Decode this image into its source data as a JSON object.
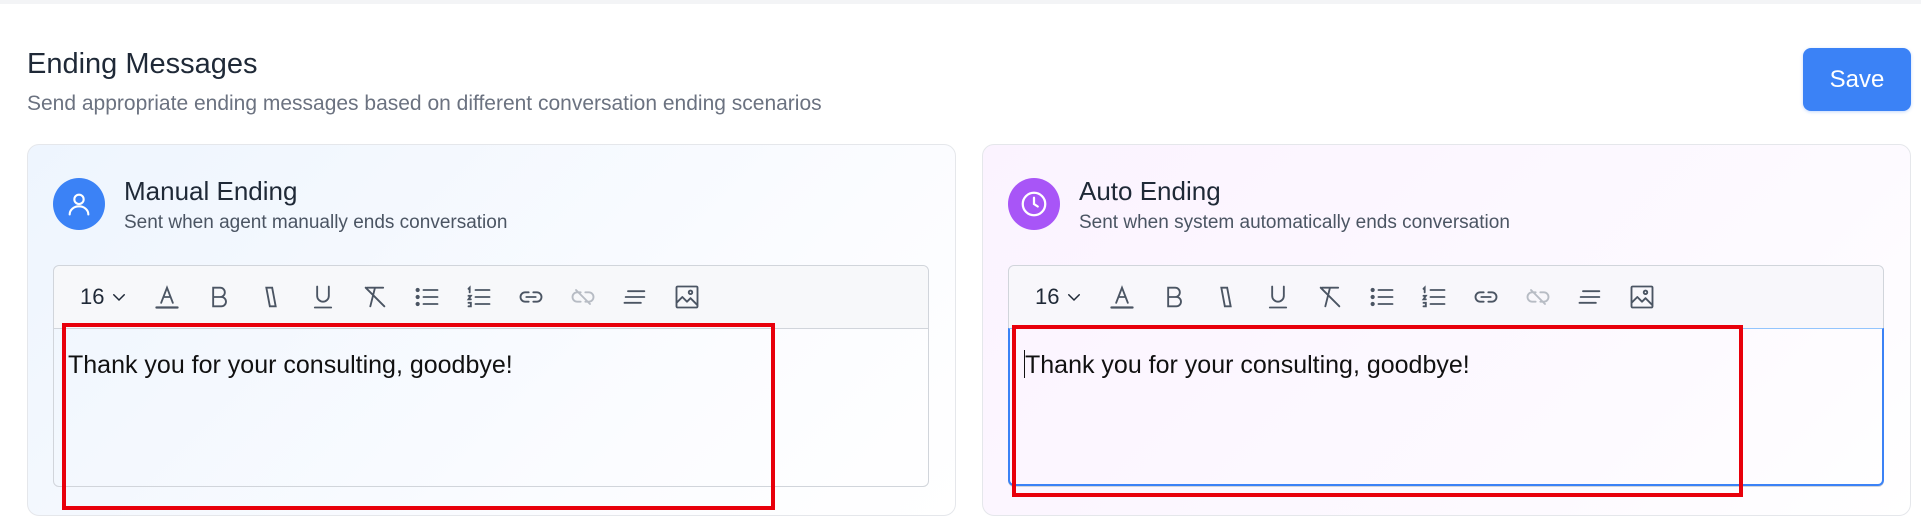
{
  "header": {
    "title": "Ending Messages",
    "subtitle": "Send appropriate ending messages based on different conversation ending scenarios",
    "save_label": "Save"
  },
  "cards": {
    "manual": {
      "title": "Manual Ending",
      "description": "Sent when agent manually ends conversation",
      "icon": "user-icon",
      "icon_color": "#3b82f6",
      "font_size": "16",
      "content": "Thank you for your consulting, goodbye!"
    },
    "auto": {
      "title": "Auto Ending",
      "description": "Sent when system automatically ends conversation",
      "icon": "clock-icon",
      "icon_color": "#a855f7",
      "font_size": "16",
      "content": "Thank you for your consulting, goodbye!"
    }
  },
  "toolbar_icons": [
    "font-color-icon",
    "bold-icon",
    "italic-icon",
    "underline-icon",
    "clear-format-icon",
    "bullet-list-icon",
    "numbered-list-icon",
    "link-icon",
    "unlink-icon",
    "align-icon",
    "image-icon"
  ],
  "colors": {
    "accent": "#3b82f6",
    "auto_accent": "#a855f7",
    "highlight": "#e8000b"
  }
}
